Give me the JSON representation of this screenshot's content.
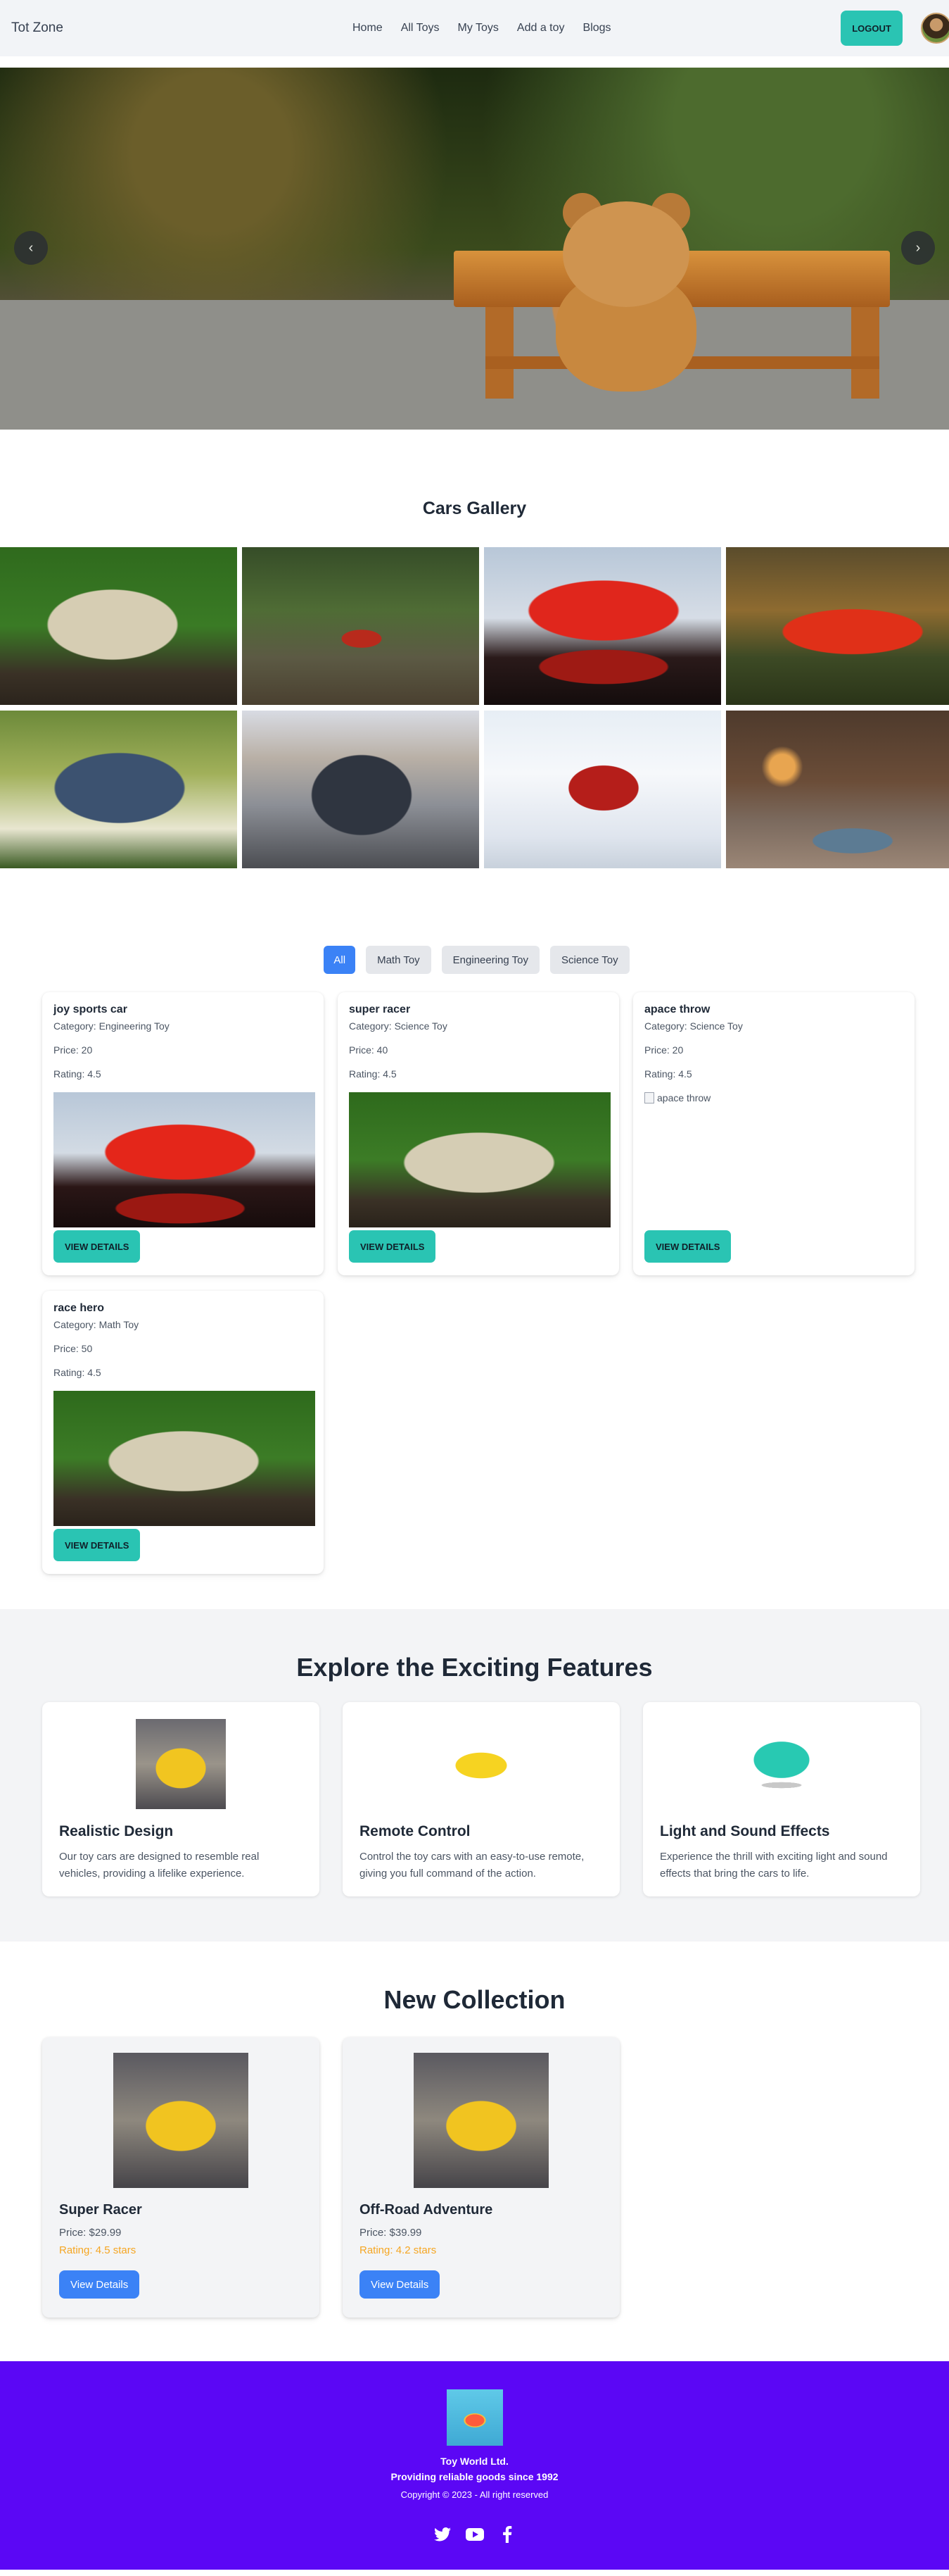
{
  "nav": {
    "brand": "Tot Zone",
    "links": [
      "Home",
      "All Toys",
      "My Toys",
      "Add a toy",
      "Blogs"
    ],
    "logout_label": "LOGOUT"
  },
  "hero": {
    "prev_icon": "chevron-left-icon",
    "next_icon": "chevron-right-icon",
    "prev_glyph": "‹",
    "next_glyph": "›"
  },
  "gallery": {
    "title": "Cars Gallery"
  },
  "filters": {
    "tabs": [
      "All",
      "Math Toy",
      "Engineering Toy",
      "Science Toy"
    ],
    "active": "All"
  },
  "toys": [
    {
      "name": "joy sports car",
      "category": "Category: Engineering Toy",
      "price": "Price: 20",
      "rating": "Rating: 4.5",
      "image": "red-sports-car",
      "button": "VIEW DETAILS"
    },
    {
      "name": "super racer",
      "category": "Category: Science Toy",
      "price": "Price: 40",
      "rating": "Rating: 4.5",
      "image": "armored-toy-car",
      "button": "VIEW DETAILS"
    },
    {
      "name": "apace throw",
      "category": "Category: Science Toy",
      "price": "Price: 20",
      "rating": "Rating: 4.5",
      "image_alt": "apace throw",
      "button": "VIEW DETAILS"
    },
    {
      "name": "race hero",
      "category": "Category: Math Toy",
      "price": "Price: 50",
      "rating": "Rating: 4.5",
      "image": "armored-toy-car",
      "button": "VIEW DETAILS"
    }
  ],
  "features": {
    "title": "Explore the Exciting Features",
    "items": [
      {
        "title": "Realistic Design",
        "desc": "Our toy cars are designed to resemble real vehicles, providing a lifelike experience."
      },
      {
        "title": "Remote Control",
        "desc": "Control the toy cars with an easy-to-use remote, giving you full command of the action."
      },
      {
        "title": "Light and Sound Effects",
        "desc": "Experience the thrill with exciting light and sound effects that bring the cars to life."
      }
    ]
  },
  "collection": {
    "title": "New Collection",
    "items": [
      {
        "name": "Super Racer",
        "price": "Price: $29.99",
        "rating": "Rating: 4.5 stars",
        "button": "View Details"
      },
      {
        "name": "Off-Road Adventure",
        "price": "Price: $39.99",
        "rating": "Rating: 4.2 stars",
        "button": "View Details"
      }
    ]
  },
  "footer": {
    "company": "Toy World Ltd.",
    "tagline": "Providing reliable goods since 1992",
    "copyright": "Copyright © 2023 - All right reserved",
    "social_icons": [
      "twitter-icon",
      "youtube-icon",
      "facebook-icon"
    ]
  },
  "colors": {
    "accent_teal": "#2ac4b3",
    "primary_blue": "#3b82f6",
    "footer_purple": "#5b07f5",
    "rating_orange": "#f5a623"
  }
}
